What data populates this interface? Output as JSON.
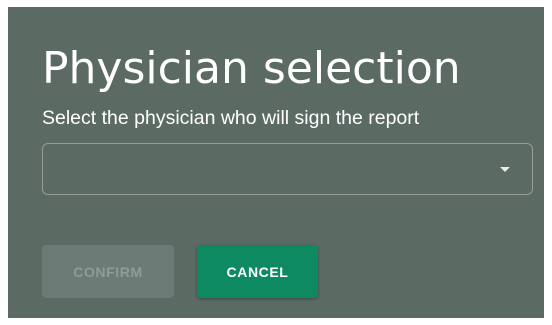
{
  "dialog": {
    "title": "Physician selection",
    "subtitle": "Select the physician who will sign the report",
    "physician_select": {
      "selected_value": ""
    },
    "buttons": {
      "confirm_label": "CONFIRM",
      "cancel_label": "CANCEL"
    },
    "colors": {
      "dialog_background": "#5b6b64",
      "confirm_disabled_background": "#6b7c76",
      "confirm_disabled_text": "#8e9c97",
      "cancel_background": "#0e8a62"
    },
    "icons": {
      "select_caret": "caret-down-icon"
    }
  }
}
